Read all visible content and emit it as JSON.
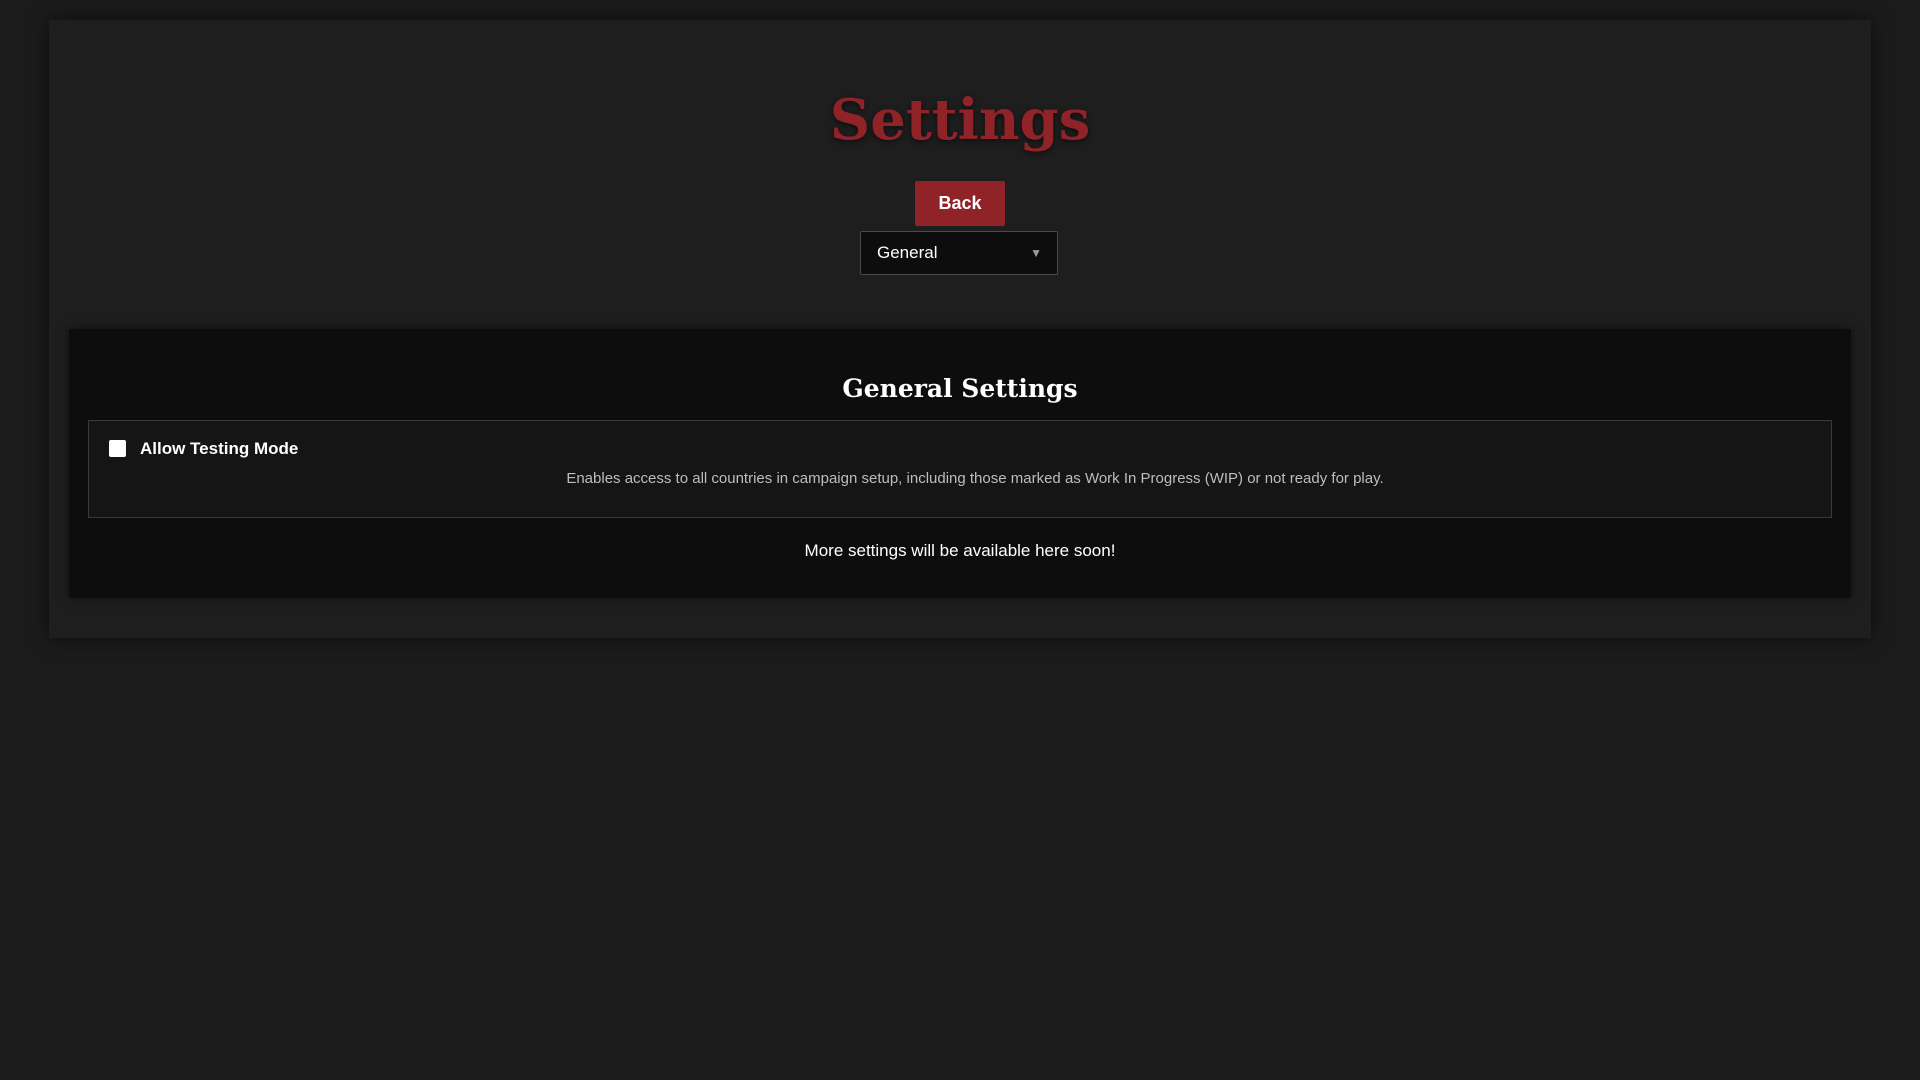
{
  "page": {
    "title": "Settings"
  },
  "toolbar": {
    "back_label": "Back"
  },
  "category_select": {
    "selected": "General",
    "arrow": "▼"
  },
  "general_settings": {
    "title": "General Settings",
    "allow_testing_mode": {
      "label": "Allow Testing Mode",
      "checked": false,
      "description": "Enables access to all countries in campaign setup, including those marked as Work In Progress (WIP) or not ready for play."
    },
    "footer_note": "More settings will be available here soon!"
  },
  "colors": {
    "accent": "#8f2328",
    "background": "#1b1b1b",
    "panel": "#0d0d0d"
  }
}
